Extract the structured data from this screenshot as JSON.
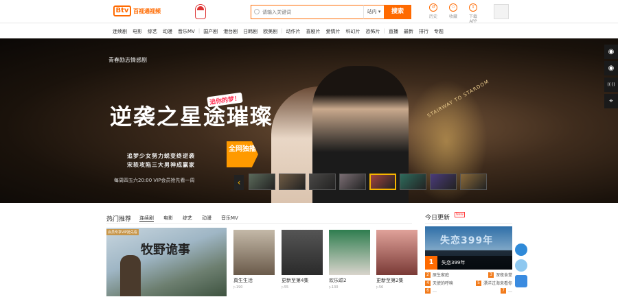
{
  "header": {
    "logo_mark": "Btv",
    "logo_text": "百视通视频",
    "search_placeholder": "请输入关键词",
    "search_scope": "站内",
    "search_button": "搜索",
    "icons": [
      {
        "name": "history-icon",
        "label": "历史"
      },
      {
        "name": "favorite-icon",
        "label": "收藏"
      },
      {
        "name": "download-icon",
        "label": "下载APP"
      }
    ]
  },
  "nav": {
    "items": [
      "连续剧",
      "电影",
      "综艺",
      "动漫",
      "音乐MV",
      "|",
      "国产剧",
      "港台剧",
      "日韩剧",
      "欧美剧",
      "|",
      "动作片",
      "喜剧片",
      "爱情片",
      "科幻片",
      "恐怖片",
      "|",
      "直播",
      "最新",
      "排行",
      "专题"
    ]
  },
  "hero": {
    "tagline": "青春励志情感剧",
    "title": "逆袭之星途璀璨",
    "stamp": "追你的梦！",
    "sub1": "追梦少女努力蜕变终逆袭",
    "sub2": "宋轶攻陷三大男神成赢家",
    "air_time": "每周四五六20:00 VIP会员抢先看一周",
    "exclusive": "全网独播",
    "stairway": "STAIRWAY TO STARDOM",
    "prev": "‹",
    "next": "›",
    "thumb_colors": [
      "#5b6a5a",
      "#6f5b44",
      "#4a4846",
      "#7a6d73",
      "#a0443f",
      "#2e6b5c",
      "#4a3b7a",
      "#8a6a3a"
    ],
    "active_thumb": 4
  },
  "side_tools": [
    {
      "name": "user-icon",
      "glyph": "◉"
    },
    {
      "name": "chat-icon",
      "glyph": "◉"
    },
    {
      "name": "broadcast-icon",
      "glyph": "((·))"
    },
    {
      "name": "location-icon",
      "glyph": "⌖"
    }
  ],
  "hot": {
    "title": "热门推荐",
    "tabs": [
      "连续剧",
      "电影",
      "综艺",
      "动漫",
      "音乐MV"
    ],
    "active_tab": 0,
    "featured": {
      "badge": "会员专享VIP抢先看",
      "title": "牧野诡事"
    },
    "cards": [
      {
        "name": "真生生活",
        "views": "▷190",
        "c1": "#6a5a4a",
        "c2": "#c4b9a8"
      },
      {
        "name": "更新至第4集",
        "views": "▷55",
        "c1": "#2a2a2a",
        "c2": "#555"
      },
      {
        "name": "欢乐颂2",
        "views": "▷130",
        "c1": "#d9d4cc",
        "c2": "#2f7d4f"
      },
      {
        "name": "更新至第2集",
        "views": "▷56",
        "c1": "#7a3a36",
        "c2": "#e0a29a"
      }
    ],
    "card_captions": [
      "真生生活",
      "更新至第4集",
      "欢乐颂2",
      "更新至第2集"
    ]
  },
  "today": {
    "title": "今日更新",
    "badge": "New",
    "image_text": "失恋399年",
    "rank_num": "1",
    "rank_title": "失恋399年",
    "list": [
      [
        {
          "n": "2",
          "t": "原生家庭"
        },
        {
          "n": "3",
          "t": "深夜食堂"
        }
      ],
      [
        {
          "n": "4",
          "t": "天使的呼唤"
        },
        {
          "n": "5",
          "t": "漂洋过海来看你"
        }
      ],
      [
        {
          "n": "6",
          "t": "…"
        },
        {
          "n": "7",
          "t": "…"
        }
      ]
    ]
  },
  "colors": {
    "accent": "#ff6a00",
    "hero_bg": "#1a120b",
    "thumb_active": "#f7b500"
  }
}
